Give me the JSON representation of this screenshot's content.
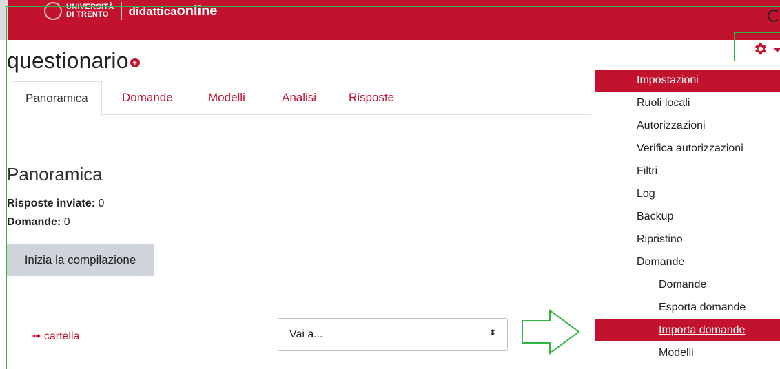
{
  "header": {
    "logo": {
      "line1": "UNIVERSITÀ",
      "line2": "DI TRENTO",
      "brand_a": "didattica",
      "brand_b": "online"
    },
    "search_icon": "search-icon",
    "accent_color": "#c2122e"
  },
  "page": {
    "title": "questionario"
  },
  "tabs": [
    {
      "label": "Panoramica",
      "active": true
    },
    {
      "label": "Domande"
    },
    {
      "label": "Modelli"
    },
    {
      "label": "Analisi"
    },
    {
      "label": "Risposte"
    }
  ],
  "overview": {
    "heading": "Panoramica",
    "responses_label": "Risposte inviate:",
    "responses_value": "0",
    "questions_label": "Domande:",
    "questions_value": "0",
    "start_button": "Inizia la compilazione"
  },
  "footer_nav": {
    "prev_link": "cartella",
    "prev_arrow": "➟",
    "jump_select": "Vai a...",
    "jump_arrows": "⬍"
  },
  "settings_menu": {
    "icon": "gear-icon",
    "items": [
      {
        "label": "Impostazioni",
        "level": 0,
        "style": "header"
      },
      {
        "label": "Ruoli locali",
        "level": 0
      },
      {
        "label": "Autorizzazioni",
        "level": 0
      },
      {
        "label": "Verifica autorizzazioni",
        "level": 0
      },
      {
        "label": "Filtri",
        "level": 0
      },
      {
        "label": "Log",
        "level": 0
      },
      {
        "label": "Backup",
        "level": 0
      },
      {
        "label": "Ripristino",
        "level": 0
      },
      {
        "label": "Domande",
        "level": 0
      },
      {
        "label": "Domande",
        "level": 1
      },
      {
        "label": "Esporta domande",
        "level": 1
      },
      {
        "label": "Importa domande",
        "level": 1,
        "style": "selected"
      },
      {
        "label": "Modelli",
        "level": 1
      }
    ]
  },
  "annotation_color": "#2fb544"
}
